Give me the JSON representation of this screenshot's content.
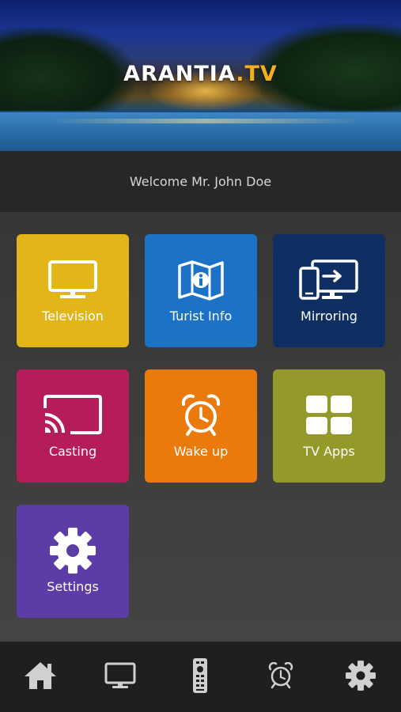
{
  "header": {
    "logo_main": "ARANTIA",
    "logo_dot": ".",
    "logo_suffix": "TV"
  },
  "welcome": {
    "text": "Welcome Mr. John Doe"
  },
  "tiles": [
    {
      "label": "Television",
      "icon": "tv-icon",
      "color": "#e2b518"
    },
    {
      "label": "Turist Info",
      "icon": "map-info-icon",
      "color": "#1c72c6"
    },
    {
      "label": "Mirroring",
      "icon": "mirroring-icon",
      "color": "#0f2f63"
    },
    {
      "label": "Casting",
      "icon": "cast-icon",
      "color": "#b51d5a"
    },
    {
      "label": "Wake up",
      "icon": "alarm-clock-icon",
      "color": "#ea7a0b"
    },
    {
      "label": "TV Apps",
      "icon": "apps-grid-icon",
      "color": "#939a29"
    },
    {
      "label": "Settings",
      "icon": "gear-icon",
      "color": "#5c3ca6"
    }
  ],
  "bottom_nav": [
    {
      "icon": "home-icon"
    },
    {
      "icon": "tv-icon"
    },
    {
      "icon": "remote-control-icon"
    },
    {
      "icon": "alarm-clock-icon"
    },
    {
      "icon": "gear-icon"
    }
  ],
  "colors": {
    "accent": "#f2b01e",
    "nav_icon": "#d0d0d0",
    "background": "#2b2b2b"
  }
}
